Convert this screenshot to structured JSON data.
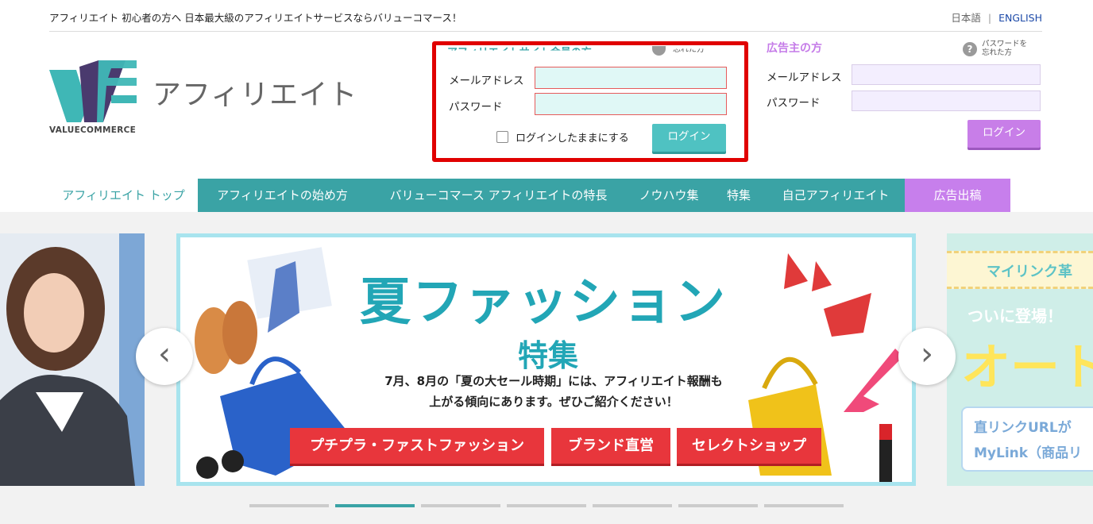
{
  "header": {
    "tagline": "アフィリエイト 初心者の方へ 日本最大級のアフィリエイトサービスならバリューコマース！",
    "lang_ja": "日本語",
    "lang_separator": "|",
    "lang_en": "ENGLISH"
  },
  "logo": {
    "text": "アフィリエイト",
    "caption": "VALUECOMMERCE"
  },
  "affiliate_login": {
    "title": "アフィリエイトサイト会員の方",
    "help_text": "忘れた方",
    "email_label": "メールアドレス",
    "email_value": "",
    "password_label": "パスワード",
    "password_value": "",
    "keep_login_label": "ログインしたままにする",
    "login_button": "ログイン"
  },
  "advertiser_login": {
    "title": "広告主の方",
    "help_icon": "?",
    "help_text_line1": "パスワードを",
    "help_text_line2": "忘れた方",
    "email_label": "メールアドレス",
    "email_value": "",
    "password_label": "パスワード",
    "password_value": "",
    "login_button": "ログイン"
  },
  "nav": {
    "items": [
      {
        "label": "アフィリエイト トップ"
      },
      {
        "label": "アフィリエイトの始め方"
      },
      {
        "label": "バリューコマース アフィリエイトの特長"
      },
      {
        "label": "ノウハウ集"
      },
      {
        "label": "特集"
      },
      {
        "label": "自己アフィリエイト"
      },
      {
        "label": "広告出稿"
      }
    ]
  },
  "carousel": {
    "slide": {
      "title": "夏ファッション",
      "subtitle": "特集",
      "description_line1": "7月、8月の「夏の大セール時期」には、アフィリエイト報酬も",
      "description_line2": "上がる傾向にあります。ぜひご紹介ください！",
      "buttons": [
        "プチプラ・ファストファッション",
        "ブランド直営",
        "セレクトショップ"
      ]
    },
    "right_slide": {
      "title": "マイリンク革",
      "subtitle": "ついに登場！",
      "big_text": "オート",
      "box_line1": "直リンクURLが",
      "box_line2": "MyLink（商品リ"
    },
    "prev_arrow": "‹",
    "next_arrow": "›",
    "dot_count": 7,
    "active_dot": 2
  },
  "colors": {
    "teal": "#3aa3a5",
    "purple": "#c77fec",
    "highlight_border": "#e00000",
    "slide_red": "#e8363c"
  }
}
